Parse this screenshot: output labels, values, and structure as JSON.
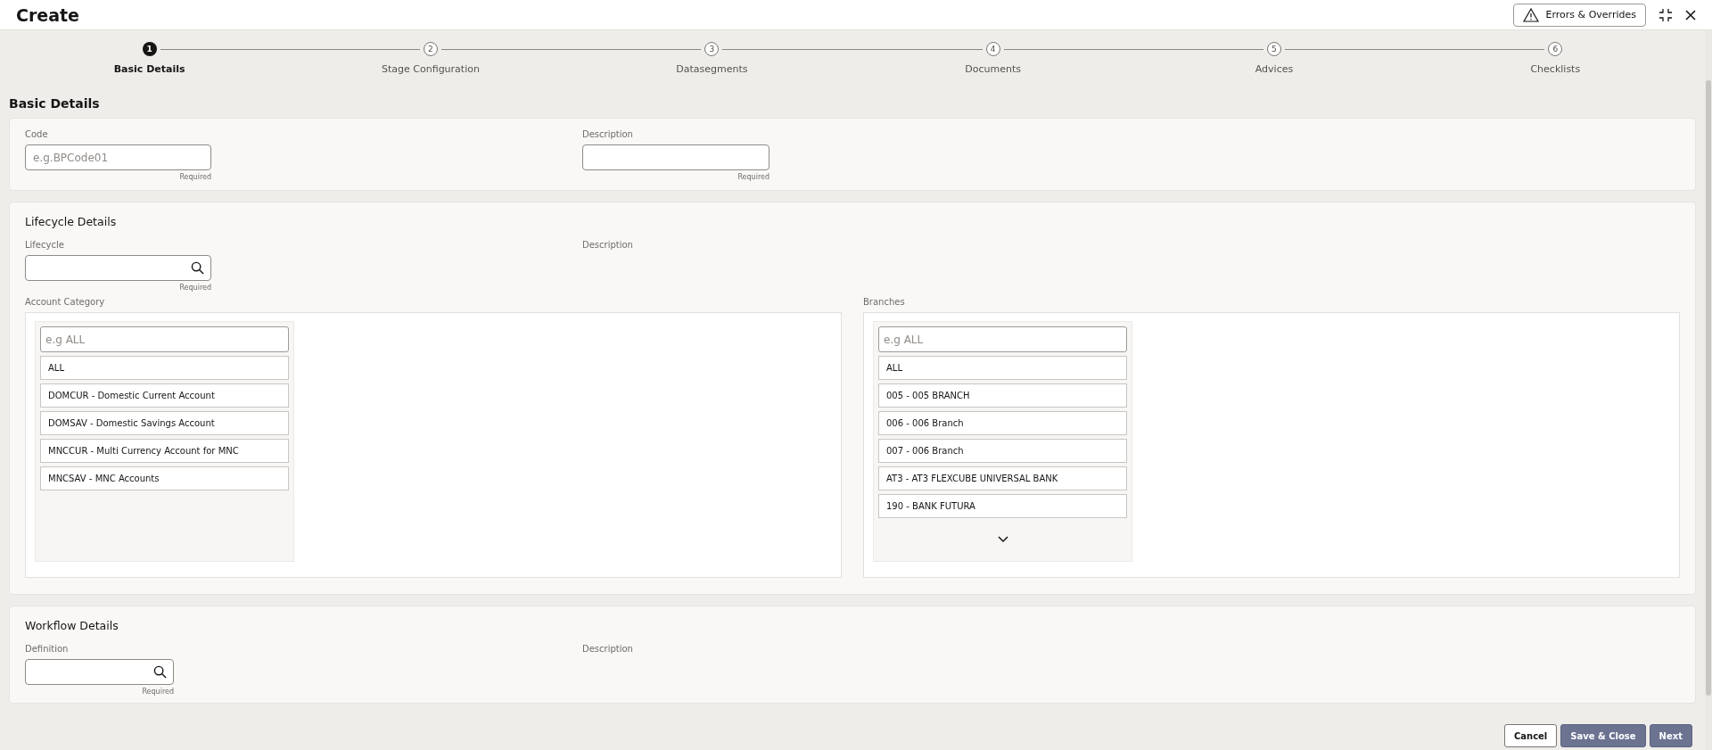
{
  "header": {
    "title": "Create",
    "errors_button": "Errors & Overrides"
  },
  "steps": [
    {
      "number": "1",
      "label": "Basic Details",
      "selected": true
    },
    {
      "number": "2",
      "label": "Stage Configuration",
      "selected": false
    },
    {
      "number": "3",
      "label": "Datasegments",
      "selected": false
    },
    {
      "number": "4",
      "label": "Documents",
      "selected": false
    },
    {
      "number": "5",
      "label": "Advices",
      "selected": false
    },
    {
      "number": "6",
      "label": "Checklists",
      "selected": false
    }
  ],
  "page_title": "Basic Details",
  "basic": {
    "code": {
      "label": "Code",
      "placeholder": "e.g.BPCode01",
      "hint": "Required"
    },
    "description": {
      "label": "Description",
      "hint": "Required"
    }
  },
  "lifecycle": {
    "title": "Lifecycle Details",
    "lifecycle": {
      "label": "Lifecycle",
      "hint": "Required"
    },
    "description_label": "Description",
    "account_category": {
      "label": "Account Category",
      "placeholder": "e.g ALL",
      "items": [
        "ALL",
        "DOMCUR - Domestic Current Account",
        "DOMSAV - Domestic Savings Account",
        "MNCCUR - Multi Currency Account for MNC",
        "MNCSAV - MNC Accounts"
      ]
    },
    "branches": {
      "label": "Branches",
      "placeholder": "e.g ALL",
      "items": [
        "ALL",
        "005 - 005 BRANCH",
        "006 - 006 Branch",
        "007 - 006 Branch",
        "AT3 - AT3 FLEXCUBE UNIVERSAL BANK",
        "190 - BANK FUTURA"
      ]
    }
  },
  "workflow": {
    "title": "Workflow Details",
    "definition": {
      "label": "Definition",
      "hint": "Required"
    },
    "description_label": "Description"
  },
  "footer": {
    "buttons": [
      {
        "label": "Cancel",
        "kind": "secondary"
      },
      {
        "label": "Save & Close",
        "kind": "primary"
      },
      {
        "label": "Next",
        "kind": "primary"
      }
    ]
  }
}
